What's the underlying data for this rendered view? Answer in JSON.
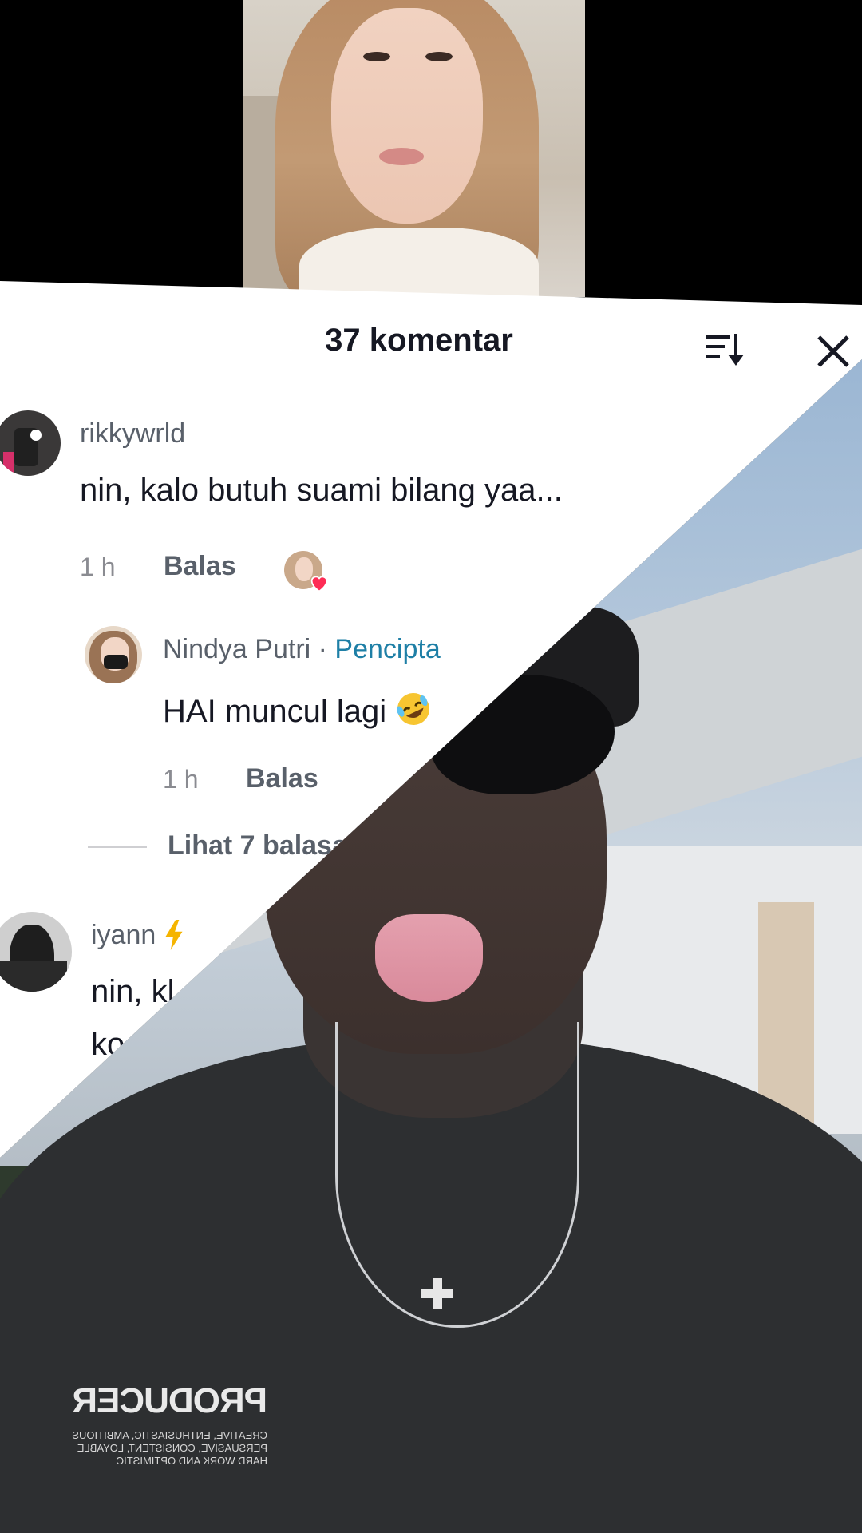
{
  "header": {
    "comment_count": "37 komentar",
    "sort_icon": "sort-icon",
    "close_icon": "close-icon"
  },
  "comments": [
    {
      "username": "rikkywrld",
      "text": "nin, kalo butuh suami bilang yaa...",
      "time": "1 h",
      "reply_label": "Balas",
      "liked_by_creator": true,
      "replies": [
        {
          "username": "Nindya Putri",
          "separator": " · ",
          "badge": "Pencipta",
          "text": "HAI muncul lagi",
          "emoji": "rolling-laughing-emoji",
          "time": "1 h",
          "reply_label": "Balas"
        }
      ],
      "view_replies": "Lihat 7 balasan"
    },
    {
      "username": "iyann",
      "username_emoji": "lightning-icon",
      "text_line1": "nin, kl",
      "text_line2": "ko"
    }
  ],
  "video_print": {
    "logo": "PRODUCER",
    "lines": [
      "CREATIVE, ENTHUSIASTIC, AMBITIOUS",
      "PERSUASIVE, CONSISTENT, LOYABLE",
      "HARD WORK AND OPTIMISTIC"
    ]
  },
  "colors": {
    "accent": "#1e7fa6",
    "heart": "#fe2c55"
  }
}
